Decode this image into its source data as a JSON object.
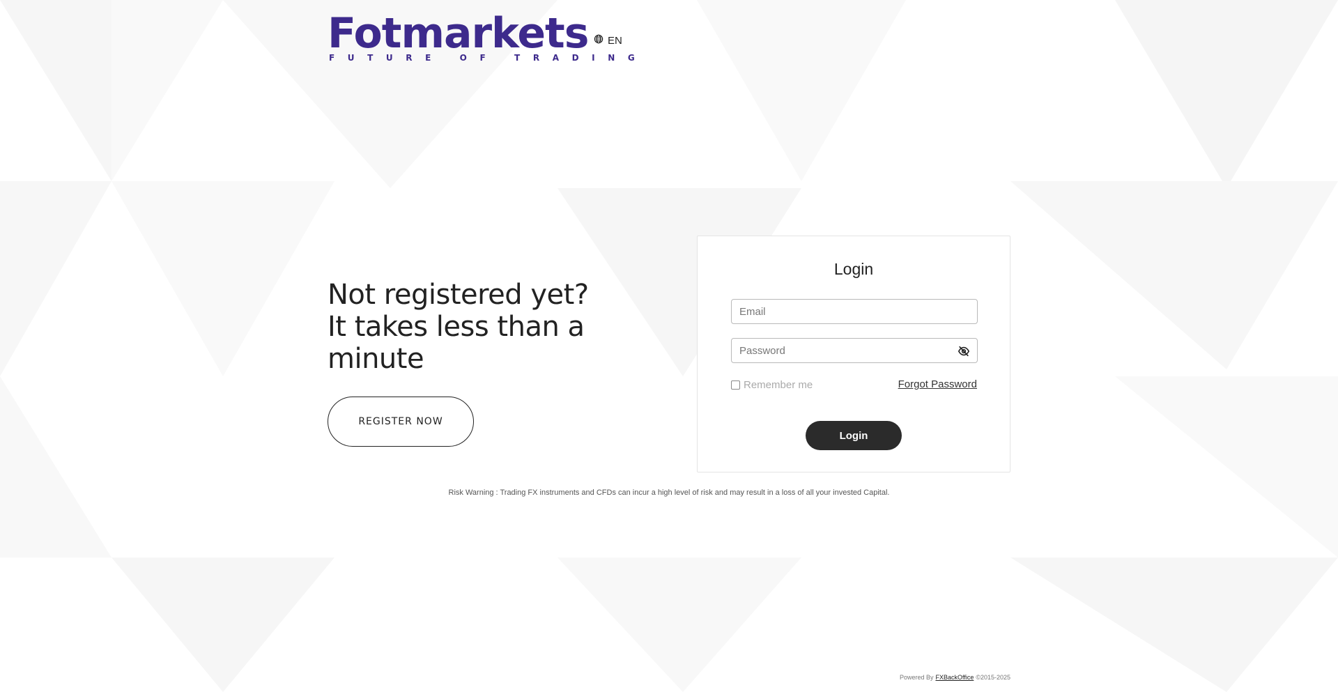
{
  "header": {
    "logo_word": "Fotmarkets",
    "logo_tagline": "FUTURE OF TRADING",
    "language": "EN",
    "brand_color": "#3d2a8c"
  },
  "promo": {
    "line1": "Not registered yet?",
    "line2": "It takes less than a",
    "line3": "minute",
    "register_label": "REGISTER NOW"
  },
  "login": {
    "title": "Login",
    "email_placeholder": "Email",
    "email_value": "",
    "password_placeholder": "Password",
    "password_value": "",
    "password_toggle_icon": "eye-slash-icon",
    "remember_label": "Remember me",
    "remember_checked": false,
    "forgot_label": "Forgot Password",
    "submit_label": "Login"
  },
  "risk_warning": "Risk Warning : Trading FX instruments and CFDs can incur a high level of risk and may result in a loss of all your invested Capital.",
  "footer": {
    "powered_by": "Powered By",
    "provider": "FXBackOffice",
    "copyright": "©2015-2025"
  }
}
